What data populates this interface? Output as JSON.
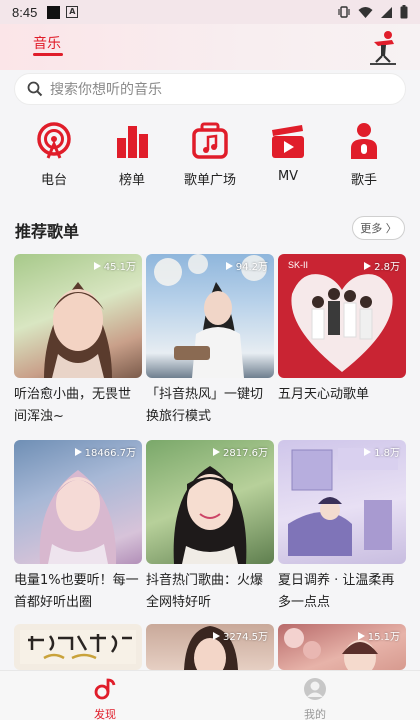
{
  "status_bar": {
    "time": "8:45"
  },
  "header": {
    "active_tab": "音乐"
  },
  "search": {
    "placeholder": "搜索你想听的音乐"
  },
  "categories": [
    {
      "label": "电台",
      "icon": "radio-icon"
    },
    {
      "label": "榜单",
      "icon": "chart-bars-icon"
    },
    {
      "label": "歌单广场",
      "icon": "playlist-box-icon"
    },
    {
      "label": "MV",
      "icon": "mv-clapper-icon"
    },
    {
      "label": "歌手",
      "icon": "singer-icon"
    }
  ],
  "section": {
    "title": "推荐歌单",
    "more_label": "更多 〉"
  },
  "playlists": [
    {
      "title": "听治愈小曲，无畏世间浑浊~",
      "plays": "45.1万"
    },
    {
      "title": "「抖音热风」一键切换旅行模式",
      "plays": "94.2万"
    },
    {
      "title": "五月天心动歌单",
      "plays": "2.8万"
    },
    {
      "title": "电量1%也要听！每一首都好听出圈",
      "plays": "18466.7万"
    },
    {
      "title": "抖音热门歌曲：火爆全网特好听",
      "plays": "2817.6万"
    },
    {
      "title": "夏日调养 · 让温柔再多一点点",
      "plays": "1.8万"
    },
    {
      "title": "",
      "plays": ""
    },
    {
      "title": "",
      "plays": "3274.5万"
    },
    {
      "title": "",
      "plays": "15.1万"
    }
  ],
  "bottom_nav": [
    {
      "label": "发现",
      "active": true
    },
    {
      "label": "我的",
      "active": false
    }
  ],
  "colors": {
    "accent": "#e01d2a",
    "background": "#f5f5f7"
  }
}
